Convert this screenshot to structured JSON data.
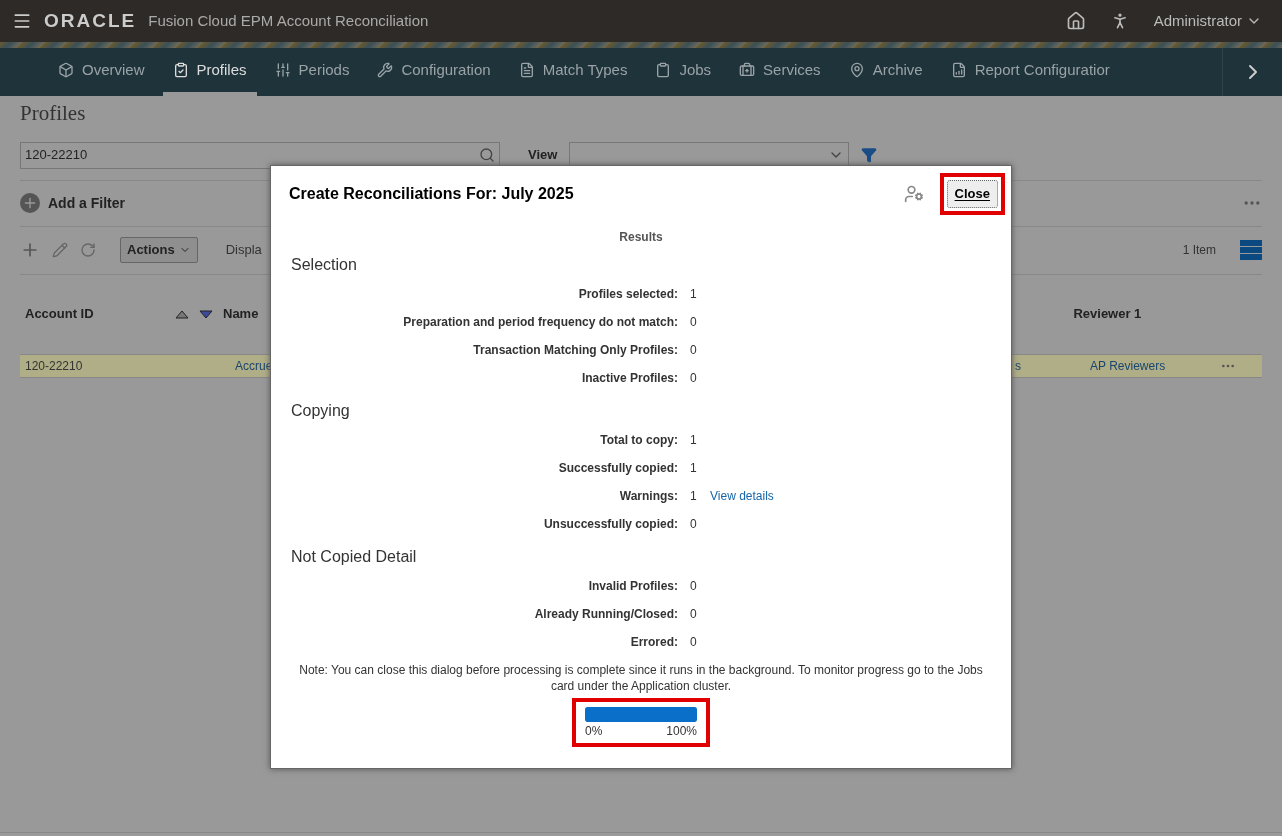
{
  "header": {
    "logo": "ORACLE",
    "product": "Fusion Cloud EPM Account Reconciliation",
    "user": "Administrator"
  },
  "nav": [
    {
      "label": "Overview",
      "selected": false
    },
    {
      "label": "Profiles",
      "selected": true
    },
    {
      "label": "Periods",
      "selected": false
    },
    {
      "label": "Configuration",
      "selected": false
    },
    {
      "label": "Match Types",
      "selected": false
    },
    {
      "label": "Jobs",
      "selected": false
    },
    {
      "label": "Services",
      "selected": false
    },
    {
      "label": "Archive",
      "selected": false
    },
    {
      "label": "Report Configuratior",
      "selected": false
    }
  ],
  "page": {
    "title": "Profiles",
    "search_value": "120-22210",
    "view_label": "View",
    "add_filter": "Add a Filter",
    "actions": "Actions",
    "display_label": "Displa",
    "item_count": "1 Item",
    "columns": [
      "Account ID",
      "Name",
      "Reviewer 1"
    ],
    "row": {
      "account_id": "120-22210",
      "name": "Accrue",
      "column_3": "s",
      "reviewer": "AP Reviewers",
      "selected": true
    }
  },
  "dialog": {
    "title": "Create Reconciliations For: July 2025",
    "close": "Close",
    "close_highlighted": true,
    "results_label": "Results",
    "sections": [
      {
        "heading": "Selection",
        "rows": [
          {
            "label": "Profiles selected:",
            "value": "1"
          },
          {
            "label": "Preparation and period frequency do not match:",
            "value": "0"
          },
          {
            "label": "Transaction Matching Only Profiles:",
            "value": "0"
          },
          {
            "label": "Inactive Profiles:",
            "value": "0"
          }
        ]
      },
      {
        "heading": "Copying",
        "rows": [
          {
            "label": "Total to copy:",
            "value": "1"
          },
          {
            "label": "Successfully copied:",
            "value": "1"
          },
          {
            "label": "Warnings:",
            "value": "1",
            "link": "View details"
          },
          {
            "label": "Unsuccessfully copied:",
            "value": "0"
          }
        ]
      },
      {
        "heading": "Not Copied Detail",
        "rows": [
          {
            "label": "Invalid Profiles:",
            "value": "0"
          },
          {
            "label": "Already Running/Closed:",
            "value": "0"
          },
          {
            "label": "Errored:",
            "value": "0"
          }
        ]
      }
    ],
    "note": "Note: You can close this dialog before processing is complete since it runs in the background. To monitor progress go to the Jobs card under the Application cluster.",
    "progress": {
      "level": 1,
      "min_label": "0%",
      "max_label": "100%",
      "highlighted": true
    }
  }
}
